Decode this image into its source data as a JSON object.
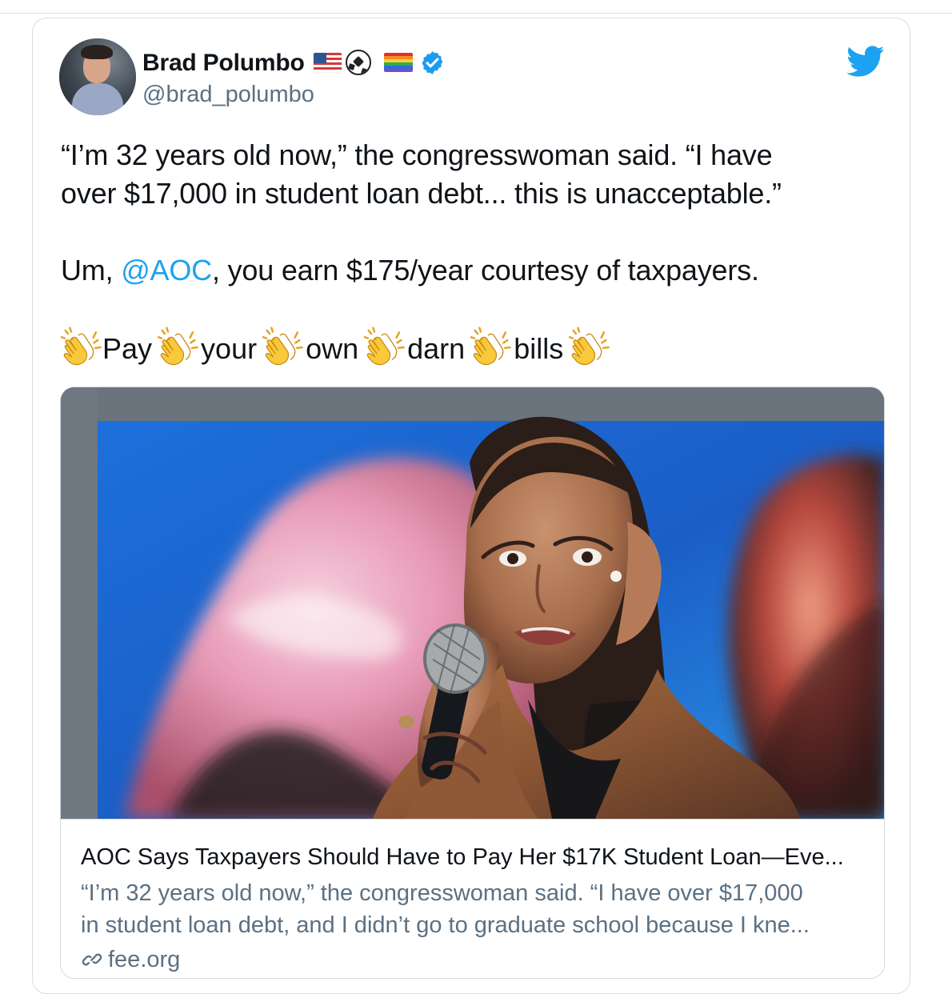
{
  "tweet": {
    "author": {
      "name": "Brad Polumbo",
      "handle": "@brad_polumbo",
      "badges": [
        "flag-icon",
        "soccer-ball-icon",
        "rainbow-icon",
        "verified-icon"
      ]
    },
    "platform_icon": "twitter-icon",
    "text": {
      "line1": "“I’m 32 years old now,” the congresswoman said. “I have",
      "line2": "over $17,000 in student loan debt... this is unacceptable.”",
      "line3_prefix": "Um, ",
      "mention": "@AOC",
      "line3_suffix": ", you earn $175/year courtesy of taxpayers.",
      "clap_words": [
        "Pay",
        "your",
        "own",
        "darn",
        "bills"
      ]
    },
    "link_card": {
      "image_icon": "photo-icon",
      "title": "AOC Says Taxpayers Should Have to Pay Her $17K Student Loan—Eve...",
      "description_line1": "“I’m 32 years old now,” the congresswoman said. “I have over $17,000",
      "description_line2": "in student loan debt, and I didn’t go to graduate school because I kne...",
      "domain": "fee.org",
      "domain_icon": "link-icon"
    }
  },
  "colors": {
    "accent": "#1da1f2",
    "text": "#0f1419",
    "secondary_text": "#5b7083",
    "border": "#cfd9de"
  }
}
